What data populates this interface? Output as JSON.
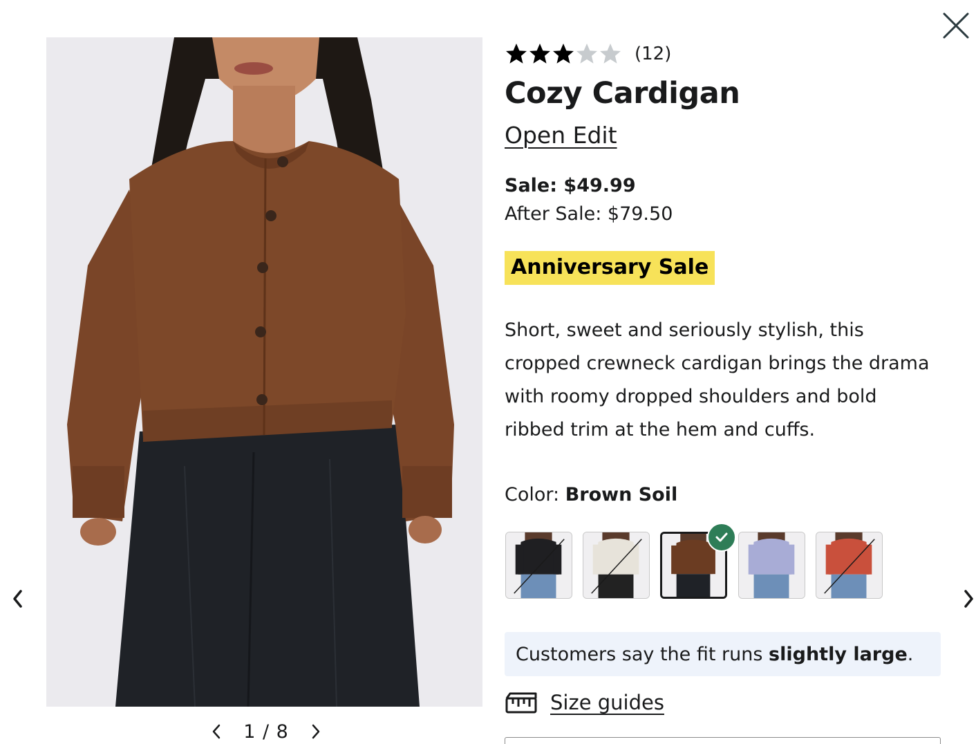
{
  "product": {
    "rating": 3,
    "rating_max": 5,
    "review_count": "(12)",
    "title": "Cozy Cardigan",
    "brand": "Open Edit",
    "sale_price": "Sale: $49.99",
    "after_sale_price": "After Sale: $79.50",
    "badge": "Anniversary Sale",
    "description": "Short, sweet and seriously stylish, this cropped crewneck cardigan brings the drama with roomy dropped shoulders and bold ribbed trim at the hem and cuffs."
  },
  "gallery": {
    "counter": "1 / 8"
  },
  "color": {
    "label": "Color: ",
    "selected": "Brown Soil",
    "swatches": [
      {
        "name": "black",
        "color": "#1f1f22",
        "available": false
      },
      {
        "name": "ivory",
        "color": "#e7e3da",
        "available": false
      },
      {
        "name": "brown-soil",
        "color": "#6b3c22",
        "available": true,
        "selected": true
      },
      {
        "name": "lavender",
        "color": "#a8acd6",
        "available": true
      },
      {
        "name": "red",
        "color": "#c9503c",
        "available": false
      }
    ]
  },
  "fit": {
    "prefix": "Customers say the fit runs ",
    "emphasis": "slightly large",
    "suffix": "."
  },
  "size_guides": {
    "label": "Size guides"
  },
  "icons": {
    "close": "close-icon",
    "prev": "chevron-left-icon",
    "next": "chevron-right-icon",
    "star": "star-icon",
    "check": "check-icon",
    "ruler": "ruler-icon"
  },
  "colors": {
    "star_filled": "#000000",
    "star_empty": "#c7cbce",
    "badge_bg": "#f7e259",
    "fit_bg": "#eef3fb",
    "check_bg": "#2e7d57"
  }
}
